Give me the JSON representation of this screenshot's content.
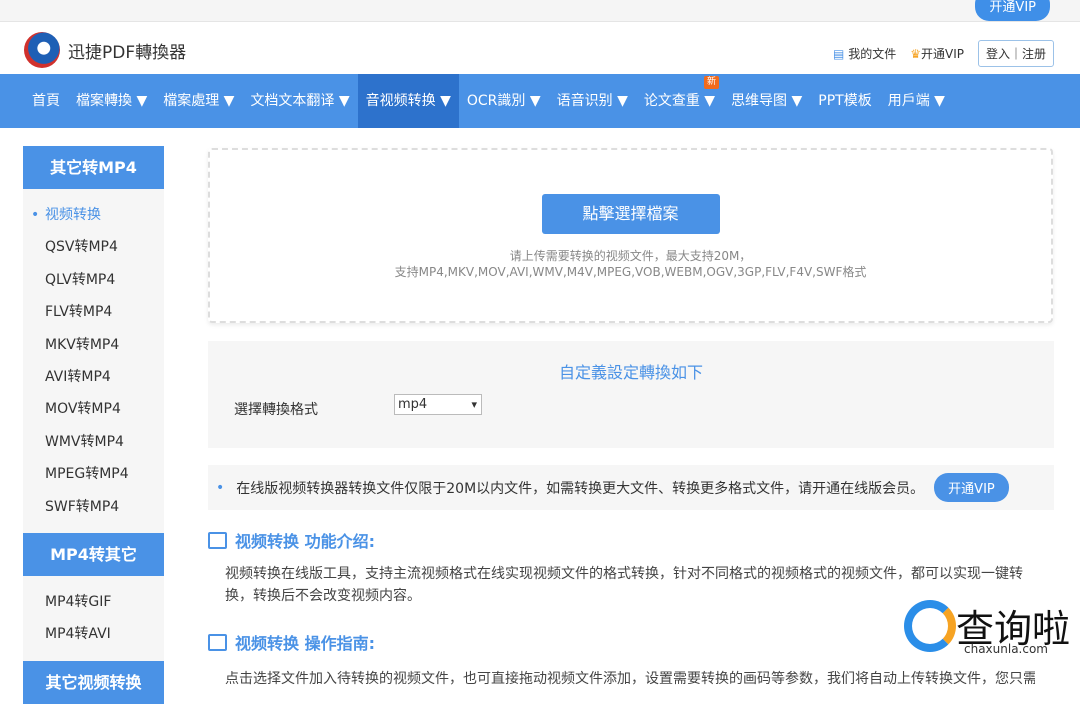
{
  "topbar": {
    "vip_button": "开通VIP"
  },
  "header": {
    "logo_text": "迅捷PDF轉換器",
    "my_files": "我的文件",
    "open_vip": "开通VIP",
    "login": "登入｜注册"
  },
  "nav": {
    "items": [
      "首頁",
      "檔案轉換 ▼",
      "檔案處理 ▼",
      "文档文本翻译 ▼",
      "音视频转换 ▼",
      "OCR識別 ▼",
      "语音识别 ▼",
      "论文查重 ▼",
      "思维导图 ▼",
      "PPT模板",
      "用戶端 ▼"
    ],
    "new_badge": "新"
  },
  "sidebar": {
    "group1": "其它转MP4",
    "items1": [
      "视频转换",
      "QSV转MP4",
      "QLV转MP4",
      "FLV转MP4",
      "MKV转MP4",
      "AVI转MP4",
      "MOV转MP4",
      "WMV转MP4",
      "MPEG转MP4",
      "SWF转MP4"
    ],
    "group2": "MP4转其它",
    "items2": [
      "MP4转GIF",
      "MP4转AVI"
    ],
    "group3": "其它视频转换"
  },
  "upload": {
    "button": "點擊選擇檔案",
    "hint1": "请上传需要转换的视频文件，最大支持20M，",
    "hint2": "支持MP4,MKV,MOV,AVI,WMV,M4V,MPEG,VOB,WEBM,OGV,3GP,FLV,F4V,SWF格式"
  },
  "settings": {
    "title": "自定義設定轉換如下",
    "format_label": "選擇轉換格式",
    "format_value": "mp4"
  },
  "notice": {
    "text": "在线版视频转换器转换文件仅限于20M以内文件，如需转换更大文件、转换更多格式文件，请开通在线版会员。",
    "vip_button": "开通VIP"
  },
  "intro": {
    "title": "视频转换 功能介绍:",
    "text": "视频转换在线版工具，支持主流视频格式在线实现视频文件的格式转换，针对不同格式的视频格式的视频文件，都可以实现一键转换，转换后不会改变视频内容。"
  },
  "guide": {
    "title": "视频转换 操作指南:",
    "text": "点击选择文件加入待转换的视频文件，也可直接拖动视频文件添加，设置需要转换的画码等参数，我们将自动上传转换文件，您只需"
  },
  "watermark": {
    "text": "查询啦",
    "url": "chaxunla.com"
  }
}
